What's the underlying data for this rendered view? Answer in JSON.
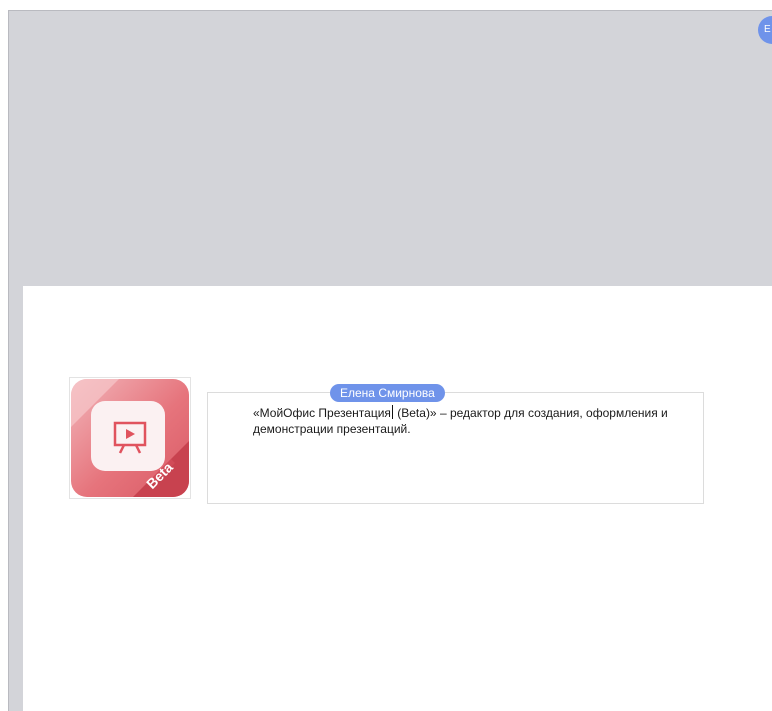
{
  "presence": {
    "avatar_initial": "Е",
    "color": "#6f93ea"
  },
  "image": {
    "icon_name": "presentation-app-icon",
    "badge_label": "Beta",
    "colors": {
      "light": "#ee9aa1",
      "main": "#e36b73",
      "dark": "#cc4050"
    }
  },
  "text_block": {
    "before_cursor": "«МойОфис Презентация",
    "after_cursor": " (Beta)»  – редактор для создания, оформления и демонстрации презентаций."
  },
  "collaborator": {
    "name": "Елена Смирнова",
    "color": "#6f93ea"
  }
}
